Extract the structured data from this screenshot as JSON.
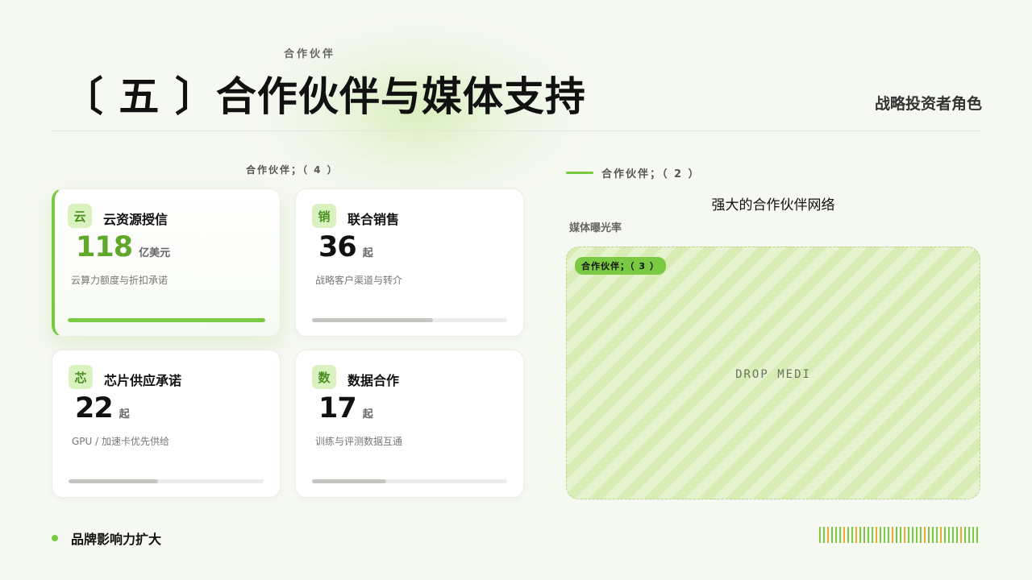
{
  "header": {
    "eyebrow": "合作伙伴",
    "title": "〔 五 〕合作伙伴与媒体支持",
    "right_subtitle": "战略投资者角色"
  },
  "left_section": {
    "label": "合作伙伴；（ 4 ）",
    "cards": [
      {
        "icon_char": "云",
        "icon": "cloud-icon",
        "title": "云资源授信",
        "value": "118",
        "unit": "亿美元",
        "desc": "云算力额度与折扣承诺",
        "progress": 1.0,
        "active": true
      },
      {
        "icon_char": "销",
        "icon": "sales-icon",
        "title": "联合销售",
        "value": "36",
        "unit": "起",
        "desc": "战略客户渠道与转介",
        "progress": 0.62,
        "active": false
      },
      {
        "icon_char": "芯",
        "icon": "chip-icon",
        "title": "芯片供应承诺",
        "value": "22",
        "unit": "起",
        "desc": "GPU / 加速卡优先供给",
        "progress": 0.46,
        "active": false
      },
      {
        "icon_char": "数",
        "icon": "data-icon",
        "title": "数据合作",
        "value": "17",
        "unit": "起",
        "desc": "训练与评测数据互通",
        "progress": 0.38,
        "active": false
      }
    ]
  },
  "right_section": {
    "label": "合作伙伴；（ 2 ）",
    "network_title": "强大的合作伙伴网络",
    "media_label": "媒体曝光率",
    "drop_tag": "合作伙伴；（ 3 ）",
    "drop_text": "DROP MEDI"
  },
  "footer": {
    "bullet_text": "品牌影响力扩大"
  },
  "colors": {
    "accent": "#7ac943",
    "accent_dark": "#5fa82a",
    "barcode_alt": "#f0a830"
  }
}
